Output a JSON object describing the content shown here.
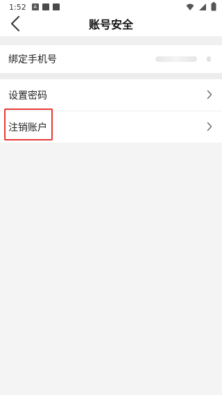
{
  "status_bar": {
    "time": "1:52",
    "notification_a_label": "A"
  },
  "header": {
    "title": "账号安全"
  },
  "account_rows": {
    "bind_phone": {
      "label": "绑定手机号"
    },
    "set_password": {
      "label": "设置密码"
    },
    "cancel_account": {
      "label": "注销账户"
    }
  },
  "icons": {
    "back": "chevron-left-icon",
    "row_arrow": "chevron-right-icon",
    "wifi": "wifi-icon",
    "signal": "signal-icon",
    "battery": "battery-icon"
  },
  "colors": {
    "highlight": "#e53935",
    "background": "#f4f4f4",
    "surface": "#ffffff"
  }
}
